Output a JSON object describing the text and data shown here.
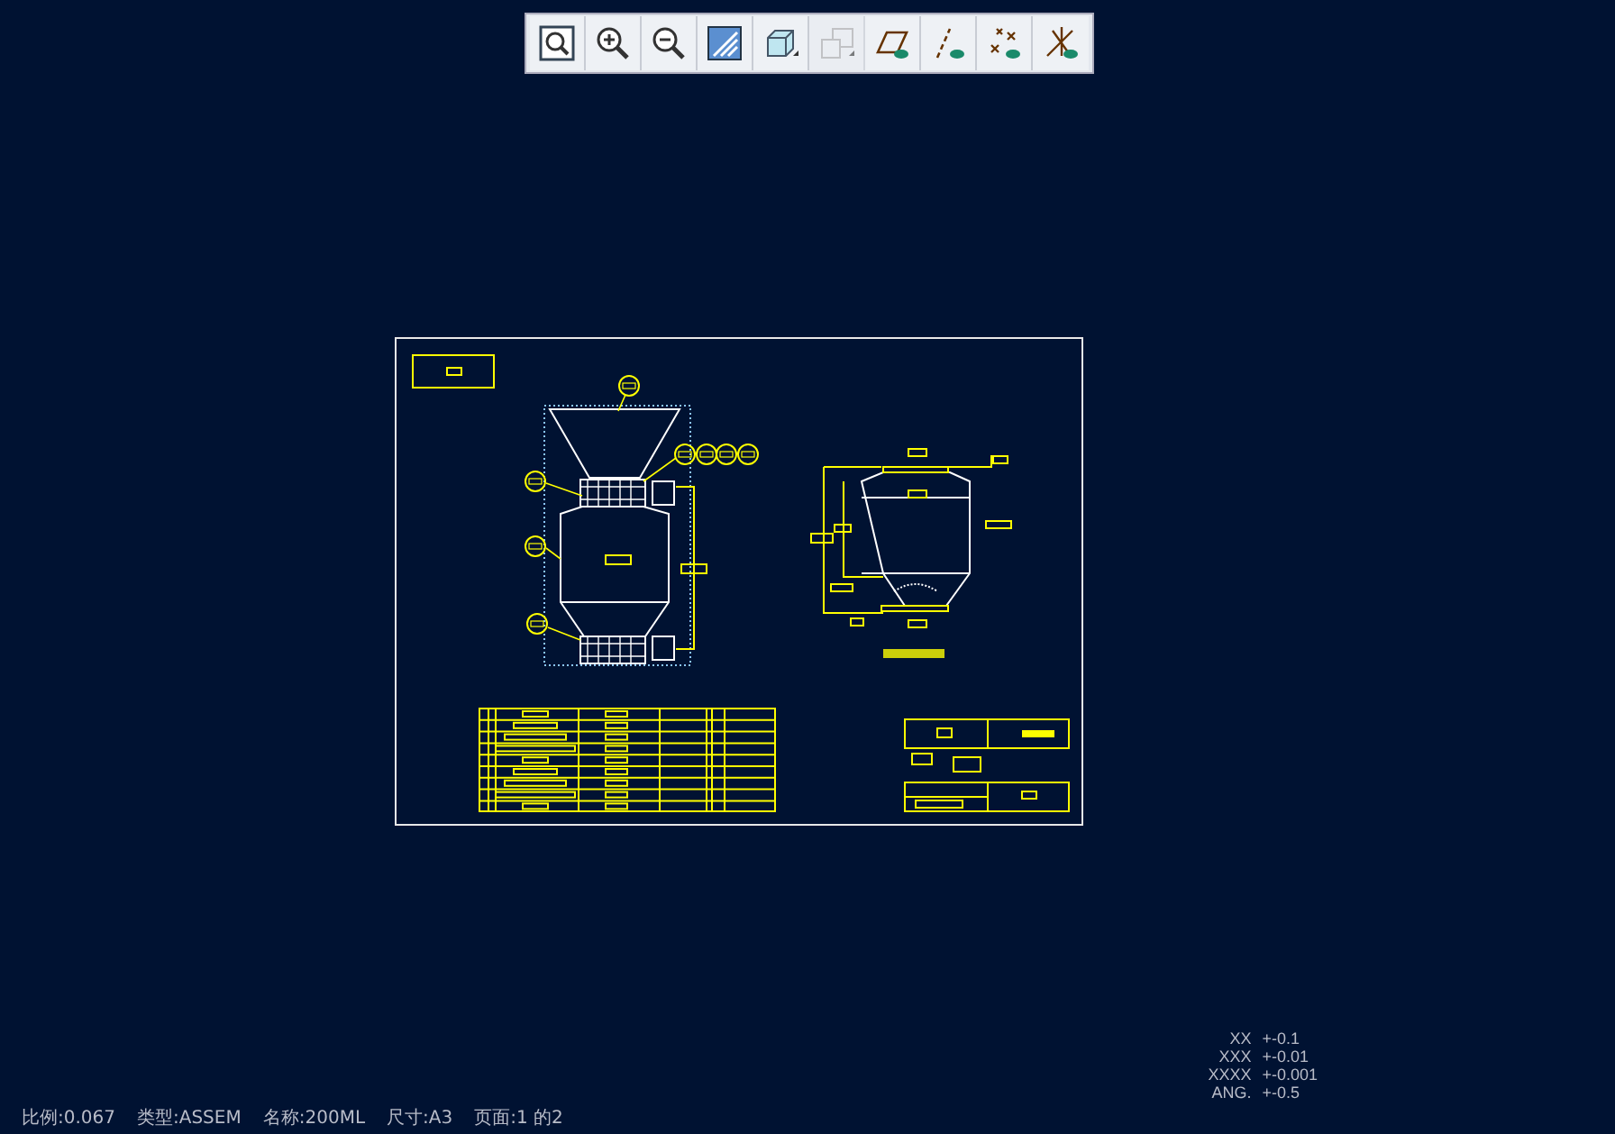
{
  "toolbar": {
    "buttons": [
      {
        "kind": "zoom-window",
        "disabled": false
      },
      {
        "kind": "zoom-in",
        "disabled": false
      },
      {
        "kind": "zoom-out",
        "disabled": false
      },
      {
        "kind": "repaint",
        "disabled": false
      },
      {
        "kind": "shade",
        "disabled": false
      },
      {
        "kind": "note-display",
        "disabled": true
      },
      {
        "kind": "plane-display",
        "disabled": false
      },
      {
        "kind": "axis-display",
        "disabled": false
      },
      {
        "kind": "point-display",
        "disabled": false
      },
      {
        "kind": "csys-display",
        "disabled": false
      }
    ]
  },
  "tolerances": [
    {
      "label": "XX",
      "value": "+-0.1"
    },
    {
      "label": "XXX",
      "value": "+-0.01"
    },
    {
      "label": "XXXX",
      "value": "+-0.001"
    },
    {
      "label": "ANG.",
      "value": "+-0.5"
    }
  ],
  "status_bar": [
    "比例:0.067",
    "类型:ASSEM",
    "名称:200ML",
    "尺寸:A3",
    "页面:1 的2"
  ]
}
